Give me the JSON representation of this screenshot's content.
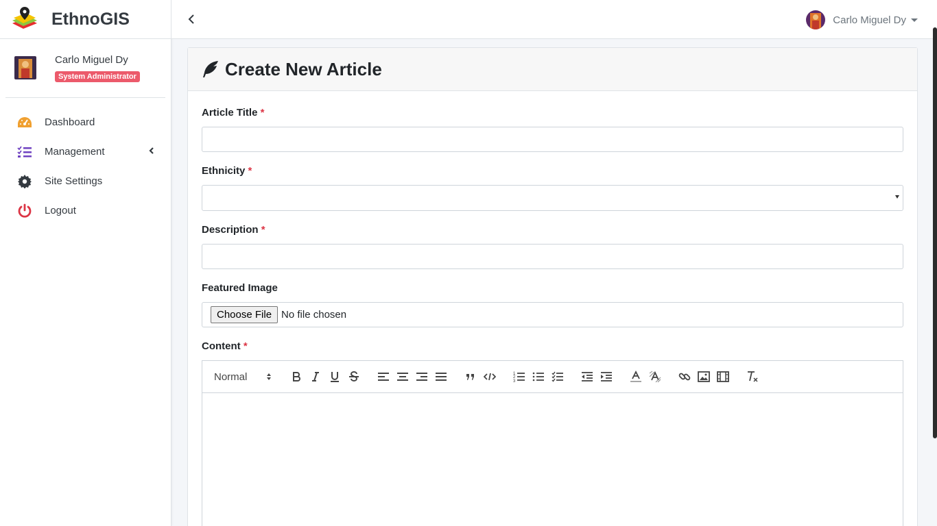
{
  "brand": {
    "name": "EthnoGIS"
  },
  "user": {
    "name": "Carlo Miguel Dy",
    "role": "System Administrator"
  },
  "sidebar": {
    "items": [
      {
        "label": "Dashboard",
        "icon": "tachometer-icon"
      },
      {
        "label": "Management",
        "icon": "tasks-icon"
      },
      {
        "label": "Site Settings",
        "icon": "gear-icon"
      },
      {
        "label": "Logout",
        "icon": "power-icon"
      }
    ]
  },
  "topbar": {
    "user_name": "Carlo Miguel Dy"
  },
  "card": {
    "title": "Create New Article"
  },
  "form": {
    "title_label": "Article Title",
    "ethnicity_label": "Ethnicity",
    "description_label": "Description",
    "image_label": "Featured Image",
    "content_label": "Content",
    "required_mark": "*",
    "file_button": "Choose File",
    "file_status": "No file chosen",
    "title_value": "",
    "description_value": "",
    "ethnicity_value": ""
  },
  "editor": {
    "heading_option": "Normal",
    "toolbar": [
      "bold",
      "italic",
      "underline",
      "strike",
      "align-left",
      "align-center",
      "align-right",
      "justify",
      "blockquote",
      "code",
      "ordered-list",
      "bullet-list",
      "check-list",
      "outdent",
      "indent",
      "text-color",
      "background-color",
      "link",
      "image",
      "video",
      "clear-format"
    ]
  },
  "colors": {
    "accent_red": "#dc3545",
    "badge": "#ec5a6b",
    "dashboard_icon": "#f0a030",
    "management_icon": "#6f42c1",
    "logout_icon": "#dc3545"
  }
}
